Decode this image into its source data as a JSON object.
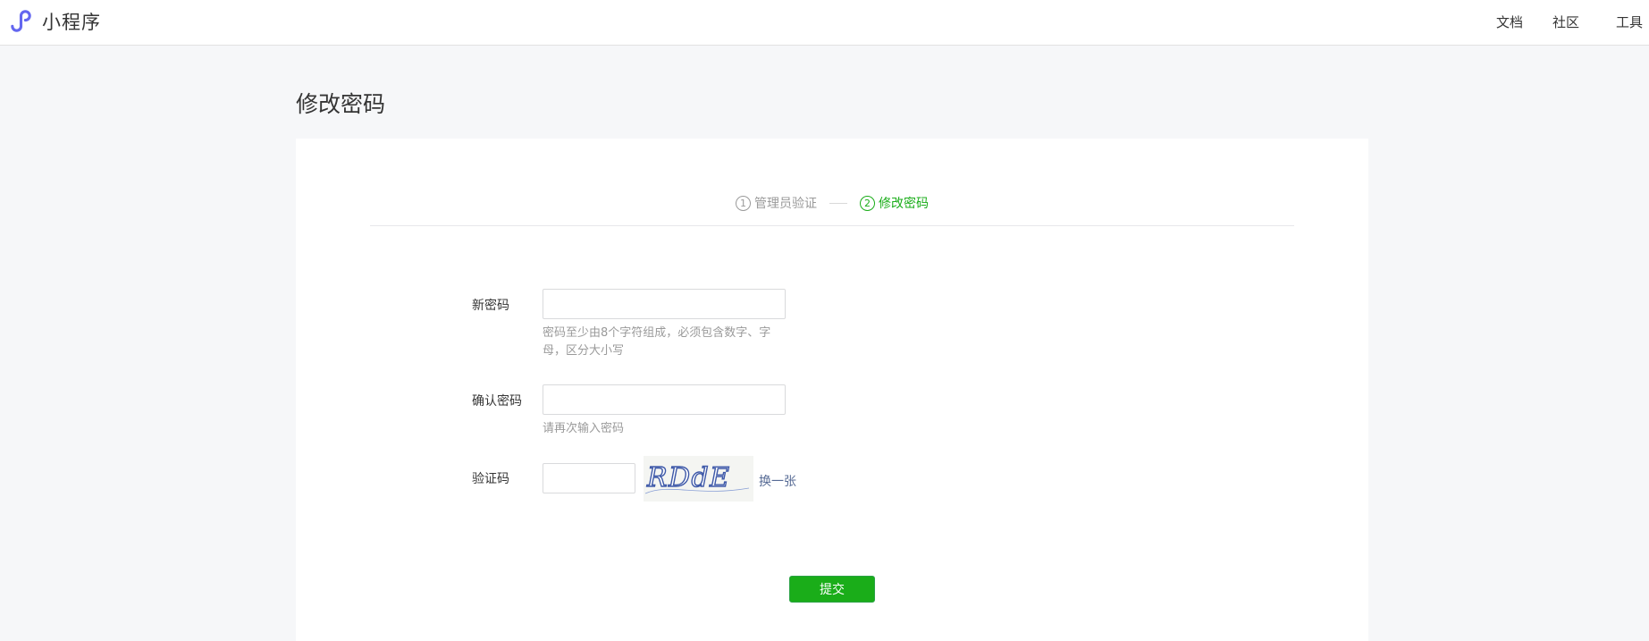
{
  "header": {
    "brand": "小程序",
    "nav": {
      "docs": "文档",
      "community": "社区",
      "tools": "工具"
    }
  },
  "page": {
    "title": "修改密码"
  },
  "steps": [
    {
      "number": "1",
      "label": "管理员验证",
      "active": false
    },
    {
      "number": "2",
      "label": "修改密码",
      "active": true
    }
  ],
  "form": {
    "new_password": {
      "label": "新密码",
      "value": "",
      "hint": "密码至少由8个字符组成，必须包含数字、字母，区分大小写"
    },
    "confirm_password": {
      "label": "确认密码",
      "value": "",
      "hint": "请再次输入密码"
    },
    "captcha": {
      "label": "验证码",
      "value": "",
      "image_text": "RDdE",
      "refresh_label": "换一张"
    },
    "submit_label": "提交"
  },
  "colors": {
    "primary_green": "#1aad19",
    "link_blue": "#576b95",
    "brand_purple": "#6467f0"
  },
  "icons": {
    "brand": "mini-program-logo-icon"
  }
}
